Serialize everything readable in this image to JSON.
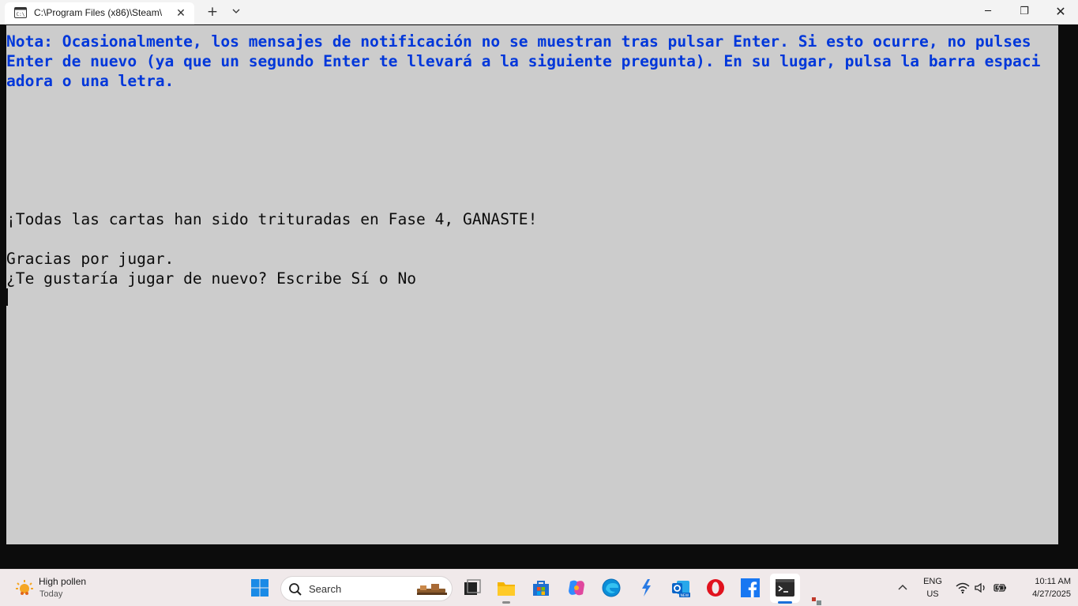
{
  "window": {
    "tab_title": "C:\\Program Files (x86)\\Steam\\",
    "tab_close": "✕",
    "new_tab": "+",
    "dropdown": "⌄",
    "minimize": "─",
    "maximize": "❐",
    "close": "✕"
  },
  "terminal": {
    "note_lines": [
      "Nota: Ocasionalmente, los mensajes de notificación no se muestran tras pulsar Enter. Si esto ocurre, no pulses",
      "Enter de nuevo (ya que un segundo Enter te llevará a la siguiente pregunta). En su lugar, pulsa la barra espaci",
      "adora o una letra."
    ],
    "result_line": "¡Todas las cartas han sido trituradas en Fase 4, GANASTE!",
    "thanks_line": "Gracias por jugar.",
    "prompt_line": "¿Te gustaría jugar de nuevo? Escribe Sí o No",
    "colors": {
      "background": "#cccccc",
      "note_text": "#0037da",
      "text": "#0c0c0c"
    }
  },
  "taskbar": {
    "weather": {
      "title": "High pollen",
      "subtitle": "Today",
      "icon": "sun-pollen-icon"
    },
    "search": {
      "label": "Search"
    },
    "apps": [
      "windows-start-icon",
      "task-view-icon",
      "file-explorer-icon",
      "microsoft-store-icon",
      "copilot-icon",
      "edge-icon",
      "lightning-app-icon",
      "outlook-new-icon",
      "opera-icon",
      "facebook-icon",
      "terminal-icon"
    ],
    "tray": {
      "chevron": "^",
      "lang_1": "ENG",
      "lang_2": "US",
      "time": "10:11 AM",
      "date": "4/27/2025"
    }
  }
}
